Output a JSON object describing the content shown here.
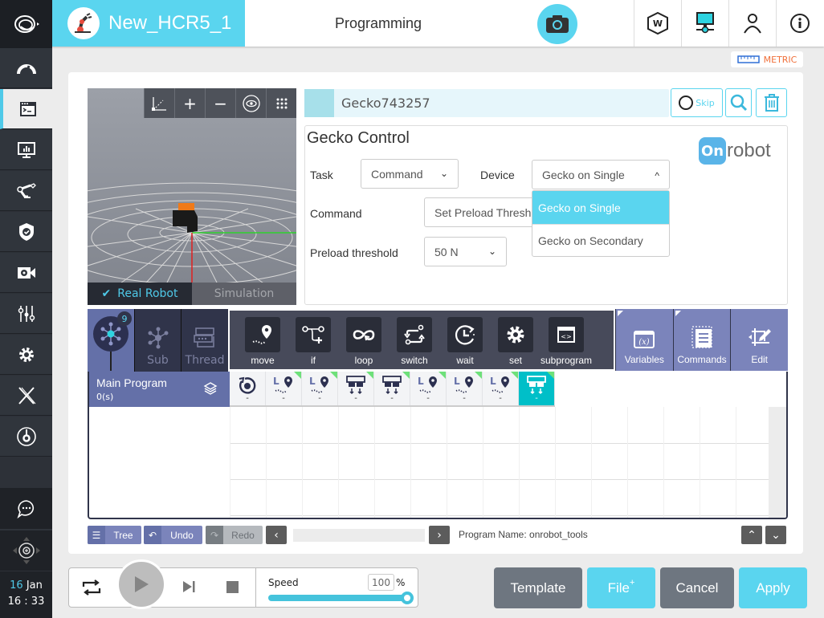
{
  "header": {
    "robot_name": "New_HCR5_1",
    "page_title": "Programming",
    "unit_badge": "METRIC",
    "icons": [
      "camera-icon",
      "wizard-icon",
      "network-icon",
      "user-icon",
      "info-icon"
    ]
  },
  "sidebar": {
    "items": [
      {
        "name": "dashboard",
        "icon": "gauge-icon"
      },
      {
        "name": "programming",
        "icon": "terminal-icon",
        "active": true
      },
      {
        "name": "monitoring",
        "icon": "monitor-chart-icon"
      },
      {
        "name": "robot",
        "icon": "robot-arm-icon"
      },
      {
        "name": "safety",
        "icon": "shield-check-icon"
      },
      {
        "name": "vision",
        "icon": "camera-gear-icon"
      },
      {
        "name": "io",
        "icon": "sliders-icon"
      },
      {
        "name": "settings",
        "icon": "gear-icon"
      },
      {
        "name": "extensions",
        "icon": "x-icon"
      },
      {
        "name": "tool",
        "icon": "target-icon"
      }
    ],
    "bottom": [
      {
        "name": "chat",
        "icon": "chat-icon"
      },
      {
        "name": "jog",
        "icon": "jog-icon"
      }
    ],
    "date_day": "16",
    "date_month": "Jan",
    "time": "16 : 33"
  },
  "viewer": {
    "tools": [
      "axes-icon",
      "zoom-in-icon",
      "zoom-out-icon",
      "eye-icon",
      "grid-dots-icon"
    ],
    "tab_real": "Real Robot",
    "tab_sim": "Simulation"
  },
  "node": {
    "name": "Gecko743257",
    "skip_label": "Skip"
  },
  "gecko": {
    "title": "Gecko Control",
    "brand": "robot",
    "task_label": "Task",
    "task_value": "Command",
    "device_label": "Device",
    "device_value": "Gecko on Single",
    "device_options": [
      "Gecko on Single",
      "Gecko on Secondary"
    ],
    "command_label": "Command",
    "command_value": "Set Preload Threshold",
    "preload_label": "Preload threshold",
    "preload_value": "50 N"
  },
  "program": {
    "main_badge": "9",
    "sub_label": "Sub",
    "thread_label": "Thread",
    "commands": [
      "move",
      "if",
      "loop",
      "switch",
      "wait",
      "set",
      "subprogram"
    ],
    "tools": [
      "Variables",
      "Commands",
      "Edit"
    ],
    "main_name": "Main Program",
    "main_time": "0(s)",
    "timeline": [
      {
        "type": "home",
        "label": "-"
      },
      {
        "type": "move-l",
        "label": "-",
        "flag": true
      },
      {
        "type": "move-l",
        "label": "-",
        "flag": true
      },
      {
        "type": "gripper",
        "label": "-",
        "flag": true
      },
      {
        "type": "gripper",
        "label": "-",
        "flag": true
      },
      {
        "type": "move-l",
        "label": "-",
        "flag": true
      },
      {
        "type": "move-l",
        "label": "-",
        "flag": true
      },
      {
        "type": "move-l",
        "label": "-",
        "flag": true
      },
      {
        "type": "gripper",
        "label": "-",
        "flag": true,
        "active": true
      }
    ]
  },
  "bottom_bar": {
    "tree": "Tree",
    "undo": "Undo",
    "redo": "Redo",
    "program_name": "Program Name: onrobot_tools"
  },
  "footer": {
    "speed_label": "Speed",
    "speed_value": "100",
    "speed_unit": "%",
    "speed_fraction": 1.0,
    "template": "Template",
    "file": "File",
    "file_sup": "+",
    "cancel": "Cancel",
    "apply": "Apply"
  }
}
